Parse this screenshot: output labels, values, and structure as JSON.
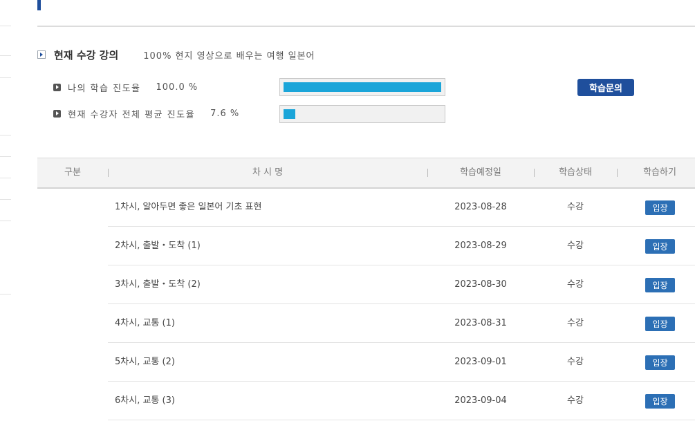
{
  "section": {
    "title": "현재 수강 강의",
    "course_name": "100% 현지 영상으로 배우는 여행 일본어"
  },
  "progress": {
    "my": {
      "label": "나의 학습 진도율",
      "value_text": "100.0 %",
      "fraction": 1.0
    },
    "average": {
      "label": "현재 수강자 전체 평균 진도율",
      "value_text": "7.6 %",
      "fraction": 0.076
    }
  },
  "inquiry_button": "학습문의",
  "table": {
    "headers": {
      "category": "구분",
      "session": "차 시 명",
      "date": "학습예정일",
      "status": "학습상태",
      "action": "학습하기"
    },
    "rows": [
      {
        "title": "1차시, 알아두면 좋은 일본어 기초 표현",
        "date": "2023-08-28",
        "status": "수강",
        "button": "입장"
      },
      {
        "title": "2차시, 출발・도착 (1)",
        "date": "2023-08-29",
        "status": "수강",
        "button": "입장"
      },
      {
        "title": "3차시, 출발・도착 (2)",
        "date": "2023-08-30",
        "status": "수강",
        "button": "입장"
      },
      {
        "title": "4차시, 교통 (1)",
        "date": "2023-08-31",
        "status": "수강",
        "button": "입장"
      },
      {
        "title": "5차시, 교통 (2)",
        "date": "2023-09-01",
        "status": "수강",
        "button": "입장"
      },
      {
        "title": "6차시, 교통 (3)",
        "date": "2023-09-04",
        "status": "수강",
        "button": "입장"
      }
    ]
  },
  "colors": {
    "accent": "#1f4f9c",
    "progress_fill": "#1ba5d9",
    "enter_button": "#2c6fb5"
  }
}
